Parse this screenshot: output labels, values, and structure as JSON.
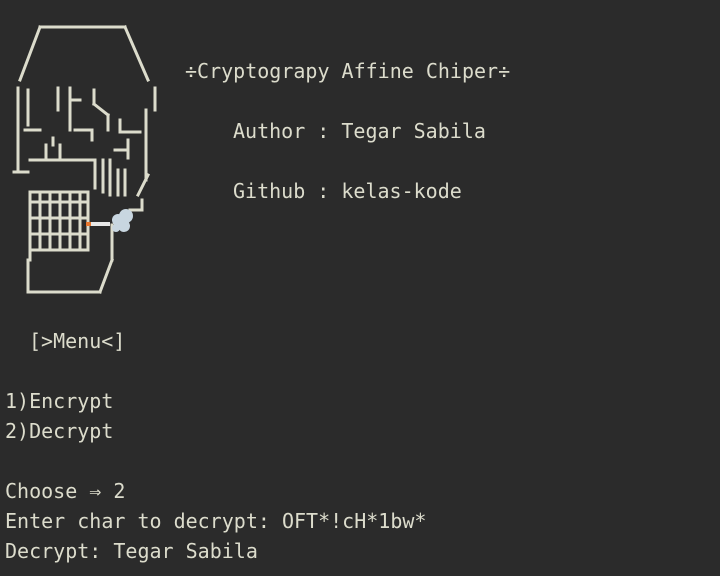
{
  "banner": {
    "title": "÷Cryptograpy Affine Chiper÷",
    "author": "Author : Tegar Sabila",
    "github": "Github : kelas-kode"
  },
  "menu": {
    "heading": "[>Menu<]",
    "options": [
      "1)Encrypt",
      "2)Decrypt"
    ]
  },
  "session": {
    "prompt_choose": "Choose ⇒ 2",
    "prompt_input": "Enter char to decrypt: OFT*!cH*1bw*",
    "result": "Decrypt: Tegar Sabila"
  },
  "icons": {
    "skull": "skull-ascii-art-icon",
    "cigarette": "cigarette-icon",
    "smoke": "smoke-icon"
  },
  "colors": {
    "background": "#2b2b2b",
    "foreground": "#dcdccc",
    "cigarette_tip": "#e8772e"
  }
}
